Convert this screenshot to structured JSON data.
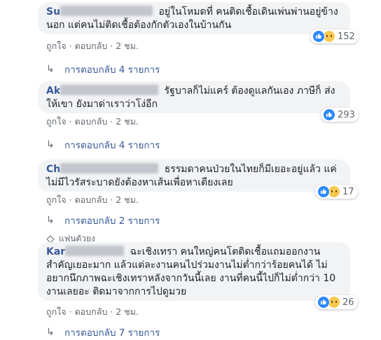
{
  "comments": [
    {
      "name": "Su",
      "text": "อยู่ในโหมดที่ คนติดเชื้อเดินเพ่นพ่านอยู่ข้าง นอก แต่คนไม่ติดเชื้อต้องกักตัวเองในบ้านกัน",
      "reaction_count": "152",
      "reactions": [
        "like-icon",
        "sad-icon"
      ],
      "like_label": "ถูกใจ",
      "reply_label": "ตอบกลับ",
      "time": "2 ชม.",
      "replies_label": "การตอบกลับ 4 รายการ"
    },
    {
      "name": "Ak",
      "text": "รัฐบาลก็ไม่แคร์ ต้องดูแลกันเอง ภาษีก็ ส่งให้เขา ยังมาด่าเราว่าโง่อีก",
      "reaction_count": "293",
      "reactions": [
        "like-icon"
      ],
      "like_label": "ถูกใจ",
      "reply_label": "ตอบกลับ",
      "time": "2 ชม.",
      "replies_label": "การตอบกลับ 4 รายการ"
    },
    {
      "name": "Ch",
      "text": "ธรรมดาคนป่วยในไทยก็มีเยอะอยู่แล้ว แค่ไม่มีไวรัสระบาดยังต้องหาเส้นเพื่อหาเตียงเลย",
      "reaction_count": "17",
      "reactions": [
        "like-icon",
        "sad-icon"
      ],
      "like_label": "ถูกใจ",
      "reply_label": "ตอบกลับ",
      "time": "2 ชม.",
      "replies_label": "การตอบกลับ 2 รายการ"
    },
    {
      "badge": "แฟนตัวยง",
      "name": "Kar",
      "text": "ฉะเชิงเทรา คนใหญ่คนโตติดเชื้อแถมออกงานสำคัญเยอะมาก แล้วแต่ละงานคนไปร่วมงานไม่ต่ำกว่าร้อยคนได้ ไม่อยากนึกภาพฉะเชิงเทราหลังจากวันนี้เลย งานที่คนนี้ไปก็ไม่ต่ำกว่า 10 งานเลยอะ ติดมาจากการไปดูมวย",
      "reaction_count": "26",
      "reactions": [
        "like-icon",
        "sad-icon"
      ],
      "like_label": "ถูกใจ",
      "reply_label": "ตอบกลับ",
      "time": "2 ชม.",
      "replies_label": "การตอบกลับ 7 รายการ"
    }
  ]
}
